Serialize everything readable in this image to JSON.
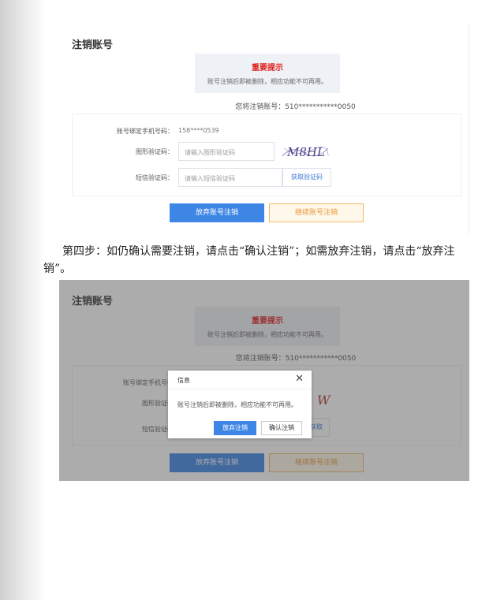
{
  "panel1": {
    "title": "注销账号",
    "notice_title": "重要提示",
    "notice_text": "账号注销后即被删除，相应功能不可再用。",
    "account_line": "您将注销账号：510***********0050",
    "phone_label": "账号绑定手机号码：",
    "phone_value": "158****0539",
    "captcha_label": "图形验证码：",
    "captcha_placeholder": "请输入图形验证码",
    "captcha_text": "M8HL",
    "sms_label": "短信验证码：",
    "sms_placeholder": "请输入短信验证码",
    "sms_button": "获取验证码",
    "abandon_button": "放弃账号注销",
    "continue_button": "继续账号注销"
  },
  "step_text": "第四步：如仍确认需要注销，请点击“确认注销”；如需放弃注销，请点击“放弃注销”。",
  "panel2": {
    "title": "注销账号",
    "notice_title": "重要提示",
    "notice_text": "账号注销后即被删除，相应功能不可再用。",
    "account_line": "您将注销账号：510***********0050",
    "phone_label": "账号绑定手机号码",
    "captcha_label": "图形验证码",
    "captcha_partial": "W",
    "sms_label": "短信验证码",
    "sms_button_partial": "获取",
    "abandon_button": "放弃账号注销",
    "continue_button": "继续账号注销",
    "dialog": {
      "title": "信息",
      "close": "✕",
      "message": "账号注销后即被删除，相应功能不可再用。",
      "abandon": "放弃注销",
      "confirm": "确认注销"
    }
  }
}
